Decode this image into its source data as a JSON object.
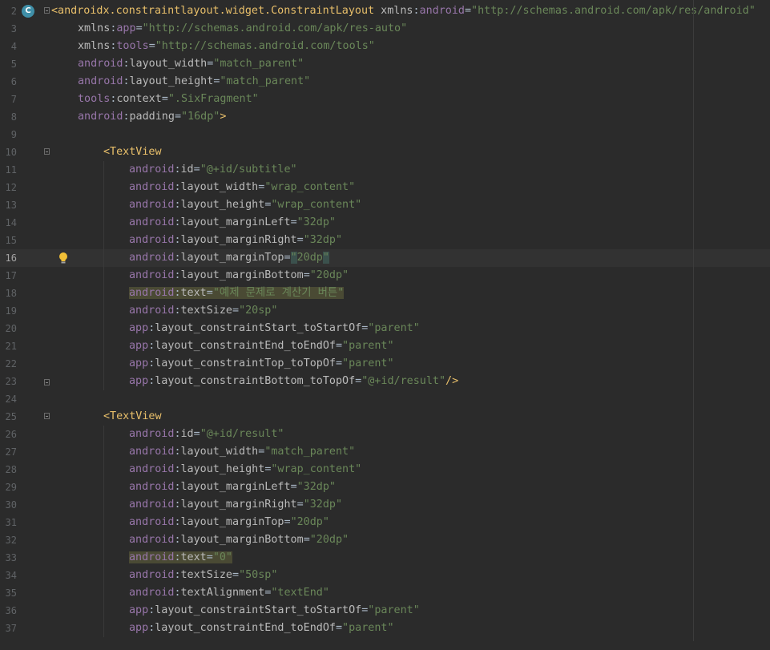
{
  "editor": {
    "current_line": 16,
    "lines": [
      {
        "num": "2",
        "indent": 0,
        "tokens": [
          [
            "tag",
            "<androidx.constraintlayout.widget.ConstraintLayout"
          ],
          [
            "plain",
            " "
          ],
          [
            "attr",
            "xmlns"
          ],
          [
            "plain",
            ":"
          ],
          [
            "ns",
            "android"
          ],
          [
            "plain",
            "="
          ],
          [
            "val",
            "\"http://schemas.android.com/apk/res/android\""
          ]
        ]
      },
      {
        "num": "3",
        "indent": 1,
        "tokens": [
          [
            "attr",
            "xmlns"
          ],
          [
            "plain",
            ":"
          ],
          [
            "ns",
            "app"
          ],
          [
            "plain",
            "="
          ],
          [
            "val",
            "\"http://schemas.android.com/apk/res-auto\""
          ]
        ]
      },
      {
        "num": "4",
        "indent": 1,
        "tokens": [
          [
            "attr",
            "xmlns"
          ],
          [
            "plain",
            ":"
          ],
          [
            "ns",
            "tools"
          ],
          [
            "plain",
            "="
          ],
          [
            "val",
            "\"http://schemas.android.com/tools\""
          ]
        ]
      },
      {
        "num": "5",
        "indent": 1,
        "tokens": [
          [
            "ns",
            "android"
          ],
          [
            "plain",
            ":"
          ],
          [
            "attr",
            "layout_width"
          ],
          [
            "plain",
            "="
          ],
          [
            "val",
            "\"match_parent\""
          ]
        ]
      },
      {
        "num": "6",
        "indent": 1,
        "tokens": [
          [
            "ns",
            "android"
          ],
          [
            "plain",
            ":"
          ],
          [
            "attr",
            "layout_height"
          ],
          [
            "plain",
            "="
          ],
          [
            "val",
            "\"match_parent\""
          ]
        ]
      },
      {
        "num": "7",
        "indent": 1,
        "tokens": [
          [
            "ns",
            "tools"
          ],
          [
            "plain",
            ":"
          ],
          [
            "attr",
            "context"
          ],
          [
            "plain",
            "="
          ],
          [
            "val",
            "\".SixFragment\""
          ]
        ]
      },
      {
        "num": "8",
        "indent": 1,
        "tokens": [
          [
            "ns",
            "android"
          ],
          [
            "plain",
            ":"
          ],
          [
            "attr",
            "padding"
          ],
          [
            "plain",
            "="
          ],
          [
            "val",
            "\"16dp\""
          ],
          [
            "tag",
            ">"
          ]
        ]
      },
      {
        "num": "9",
        "indent": 0,
        "tokens": []
      },
      {
        "num": "10",
        "indent": 2,
        "tokens": [
          [
            "tag",
            "<TextView"
          ]
        ]
      },
      {
        "num": "11",
        "indent": 3,
        "tokens": [
          [
            "ns",
            "android"
          ],
          [
            "plain",
            ":"
          ],
          [
            "attr",
            "id"
          ],
          [
            "plain",
            "="
          ],
          [
            "val",
            "\"@+id/subtitle\""
          ]
        ]
      },
      {
        "num": "12",
        "indent": 3,
        "tokens": [
          [
            "ns",
            "android"
          ],
          [
            "plain",
            ":"
          ],
          [
            "attr",
            "layout_width"
          ],
          [
            "plain",
            "="
          ],
          [
            "val",
            "\"wrap_content\""
          ]
        ]
      },
      {
        "num": "13",
        "indent": 3,
        "tokens": [
          [
            "ns",
            "android"
          ],
          [
            "plain",
            ":"
          ],
          [
            "attr",
            "layout_height"
          ],
          [
            "plain",
            "="
          ],
          [
            "val",
            "\"wrap_content\""
          ]
        ]
      },
      {
        "num": "14",
        "indent": 3,
        "tokens": [
          [
            "ns",
            "android"
          ],
          [
            "plain",
            ":"
          ],
          [
            "attr",
            "layout_marginLeft"
          ],
          [
            "plain",
            "="
          ],
          [
            "val",
            "\"32dp\""
          ]
        ]
      },
      {
        "num": "15",
        "indent": 3,
        "tokens": [
          [
            "ns",
            "android"
          ],
          [
            "plain",
            ":"
          ],
          [
            "attr",
            "layout_marginRight"
          ],
          [
            "plain",
            "="
          ],
          [
            "val",
            "\"32dp\""
          ]
        ]
      },
      {
        "num": "16",
        "indent": 3,
        "tokens": [
          [
            "ns",
            "android"
          ],
          [
            "plain",
            ":"
          ],
          [
            "attr",
            "layout_marginTop"
          ],
          [
            "plain",
            "="
          ],
          [
            "q",
            "\""
          ],
          [
            "val",
            "20dp"
          ],
          [
            "q",
            "\""
          ]
        ]
      },
      {
        "num": "17",
        "indent": 3,
        "tokens": [
          [
            "ns",
            "android"
          ],
          [
            "plain",
            ":"
          ],
          [
            "attr",
            "layout_marginBottom"
          ],
          [
            "plain",
            "="
          ],
          [
            "val",
            "\"20dp\""
          ]
        ]
      },
      {
        "num": "18",
        "indent": 3,
        "hl": true,
        "tokens": [
          [
            "ns",
            "android"
          ],
          [
            "plain",
            ":"
          ],
          [
            "attr",
            "text"
          ],
          [
            "plain",
            "="
          ],
          [
            "val",
            "\"예제 문제로 계산기 버튼\""
          ]
        ]
      },
      {
        "num": "19",
        "indent": 3,
        "tokens": [
          [
            "ns",
            "android"
          ],
          [
            "plain",
            ":"
          ],
          [
            "attr",
            "textSize"
          ],
          [
            "plain",
            "="
          ],
          [
            "val",
            "\"20sp\""
          ]
        ]
      },
      {
        "num": "20",
        "indent": 3,
        "tokens": [
          [
            "ns",
            "app"
          ],
          [
            "plain",
            ":"
          ],
          [
            "attr",
            "layout_constraintStart_toStartOf"
          ],
          [
            "plain",
            "="
          ],
          [
            "val",
            "\"parent\""
          ]
        ]
      },
      {
        "num": "21",
        "indent": 3,
        "tokens": [
          [
            "ns",
            "app"
          ],
          [
            "plain",
            ":"
          ],
          [
            "attr",
            "layout_constraintEnd_toEndOf"
          ],
          [
            "plain",
            "="
          ],
          [
            "val",
            "\"parent\""
          ]
        ]
      },
      {
        "num": "22",
        "indent": 3,
        "tokens": [
          [
            "ns",
            "app"
          ],
          [
            "plain",
            ":"
          ],
          [
            "attr",
            "layout_constraintTop_toTopOf"
          ],
          [
            "plain",
            "="
          ],
          [
            "val",
            "\"parent\""
          ]
        ]
      },
      {
        "num": "23",
        "indent": 3,
        "tokens": [
          [
            "ns",
            "app"
          ],
          [
            "plain",
            ":"
          ],
          [
            "attr",
            "layout_constraintBottom_toTopOf"
          ],
          [
            "plain",
            "="
          ],
          [
            "val",
            "\"@+id/result\""
          ],
          [
            "tag",
            "/>"
          ]
        ]
      },
      {
        "num": "24",
        "indent": 0,
        "tokens": []
      },
      {
        "num": "25",
        "indent": 2,
        "tokens": [
          [
            "tag",
            "<TextView"
          ]
        ]
      },
      {
        "num": "26",
        "indent": 3,
        "tokens": [
          [
            "ns",
            "android"
          ],
          [
            "plain",
            ":"
          ],
          [
            "attr",
            "id"
          ],
          [
            "plain",
            "="
          ],
          [
            "val",
            "\"@+id/result\""
          ]
        ]
      },
      {
        "num": "27",
        "indent": 3,
        "tokens": [
          [
            "ns",
            "android"
          ],
          [
            "plain",
            ":"
          ],
          [
            "attr",
            "layout_width"
          ],
          [
            "plain",
            "="
          ],
          [
            "val",
            "\"match_parent\""
          ]
        ]
      },
      {
        "num": "28",
        "indent": 3,
        "tokens": [
          [
            "ns",
            "android"
          ],
          [
            "plain",
            ":"
          ],
          [
            "attr",
            "layout_height"
          ],
          [
            "plain",
            "="
          ],
          [
            "val",
            "\"wrap_content\""
          ]
        ]
      },
      {
        "num": "29",
        "indent": 3,
        "tokens": [
          [
            "ns",
            "android"
          ],
          [
            "plain",
            ":"
          ],
          [
            "attr",
            "layout_marginLeft"
          ],
          [
            "plain",
            "="
          ],
          [
            "val",
            "\"32dp\""
          ]
        ]
      },
      {
        "num": "30",
        "indent": 3,
        "tokens": [
          [
            "ns",
            "android"
          ],
          [
            "plain",
            ":"
          ],
          [
            "attr",
            "layout_marginRight"
          ],
          [
            "plain",
            "="
          ],
          [
            "val",
            "\"32dp\""
          ]
        ]
      },
      {
        "num": "31",
        "indent": 3,
        "tokens": [
          [
            "ns",
            "android"
          ],
          [
            "plain",
            ":"
          ],
          [
            "attr",
            "layout_marginTop"
          ],
          [
            "plain",
            "="
          ],
          [
            "val",
            "\"20dp\""
          ]
        ]
      },
      {
        "num": "32",
        "indent": 3,
        "tokens": [
          [
            "ns",
            "android"
          ],
          [
            "plain",
            ":"
          ],
          [
            "attr",
            "layout_marginBottom"
          ],
          [
            "plain",
            "="
          ],
          [
            "val",
            "\"20dp\""
          ]
        ]
      },
      {
        "num": "33",
        "indent": 3,
        "hl": true,
        "tokens": [
          [
            "ns",
            "android"
          ],
          [
            "plain",
            ":"
          ],
          [
            "attr",
            "text"
          ],
          [
            "plain",
            "="
          ],
          [
            "val",
            "\"0\""
          ]
        ]
      },
      {
        "num": "34",
        "indent": 3,
        "tokens": [
          [
            "ns",
            "android"
          ],
          [
            "plain",
            ":"
          ],
          [
            "attr",
            "textSize"
          ],
          [
            "plain",
            "="
          ],
          [
            "val",
            "\"50sp\""
          ]
        ]
      },
      {
        "num": "35",
        "indent": 3,
        "tokens": [
          [
            "ns",
            "android"
          ],
          [
            "plain",
            ":"
          ],
          [
            "attr",
            "textAlignment"
          ],
          [
            "plain",
            "="
          ],
          [
            "val",
            "\"textEnd\""
          ]
        ]
      },
      {
        "num": "36",
        "indent": 3,
        "tokens": [
          [
            "ns",
            "app"
          ],
          [
            "plain",
            ":"
          ],
          [
            "attr",
            "layout_constraintStart_toStartOf"
          ],
          [
            "plain",
            "="
          ],
          [
            "val",
            "\"parent\""
          ]
        ]
      },
      {
        "num": "37",
        "indent": 3,
        "tokens": [
          [
            "ns",
            "app"
          ],
          [
            "plain",
            ":"
          ],
          [
            "attr",
            "layout_constraintEnd_toEndOf"
          ],
          [
            "plain",
            "="
          ],
          [
            "val",
            "\"parent\""
          ]
        ]
      }
    ],
    "fold_lines": [
      "2",
      "10",
      "23",
      "25"
    ],
    "fold_end_lines": [
      "23"
    ],
    "gutter_icons": {
      "2": "class-badge-icon",
      "16": "lightbulb-icon"
    },
    "badge_letter": "C"
  }
}
